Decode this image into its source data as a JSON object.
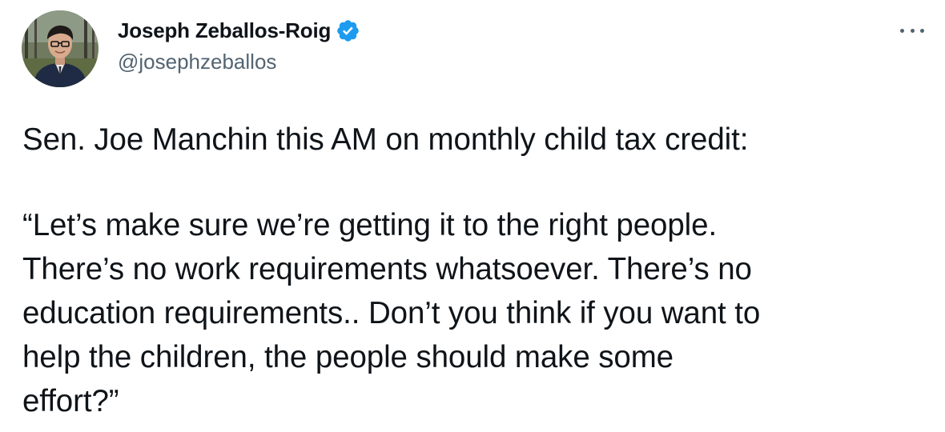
{
  "author": {
    "display_name": "Joseph Zeballos-Roig",
    "handle": "@josephzeballos",
    "verified_icon": "verified-badge-icon",
    "avatar_icon": "avatar-photo"
  },
  "menu": {
    "more_icon": "more-options-icon"
  },
  "tweet": {
    "lines": [
      "Sen. Joe Manchin this AM on monthly child tax credit:",
      "“Let’s make sure we’re getting it to the right people.",
      "There’s no work requirements whatsoever. There’s no",
      "education requirements.. Don’t you think if you want to",
      "help the children, the people should make some",
      "effort?”"
    ]
  },
  "colors": {
    "text": "#0f1419",
    "secondary": "#536471",
    "verified": "#1d9bf0"
  }
}
